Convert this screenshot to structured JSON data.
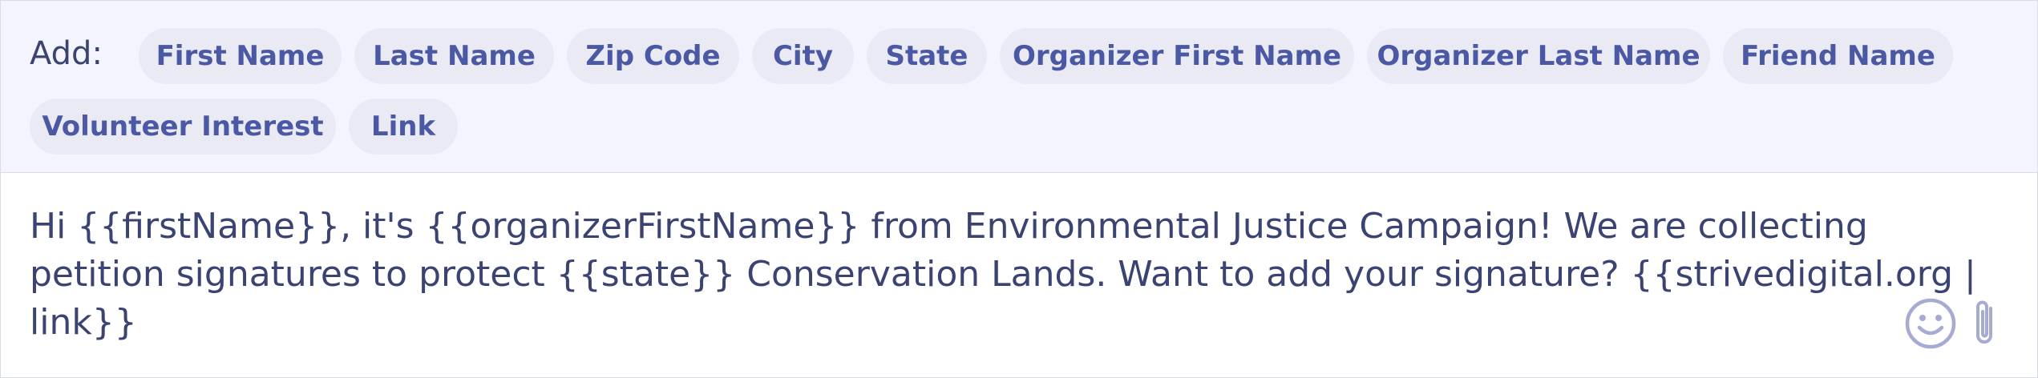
{
  "tagbar": {
    "add_label": "Add:",
    "chips": [
      {
        "label": "First Name"
      },
      {
        "label": "Last Name"
      },
      {
        "label": "Zip Code"
      },
      {
        "label": "City"
      },
      {
        "label": "State"
      },
      {
        "label": "Organizer First Name"
      },
      {
        "label": "Organizer Last Name"
      },
      {
        "label": "Friend Name"
      },
      {
        "label": "Volunteer Interest"
      },
      {
        "label": "Link"
      }
    ]
  },
  "composer": {
    "message": "Hi {{firstName}}, it's {{organizerFirstName}} from Environmental Justice Campaign! We are collecting petition signatures to protect {{state}} Conservation Lands. Want to add your signature? {{strivedigital.org | link}}",
    "icons": {
      "emoji": "smiley-icon",
      "attach": "paperclip-icon"
    }
  },
  "colors": {
    "chip_text": "#4b58a3",
    "chip_bg": "#e9eaf3",
    "bar_bg": "#f3f4fd",
    "text": "#3a4372",
    "icon": "#a6abd2"
  }
}
